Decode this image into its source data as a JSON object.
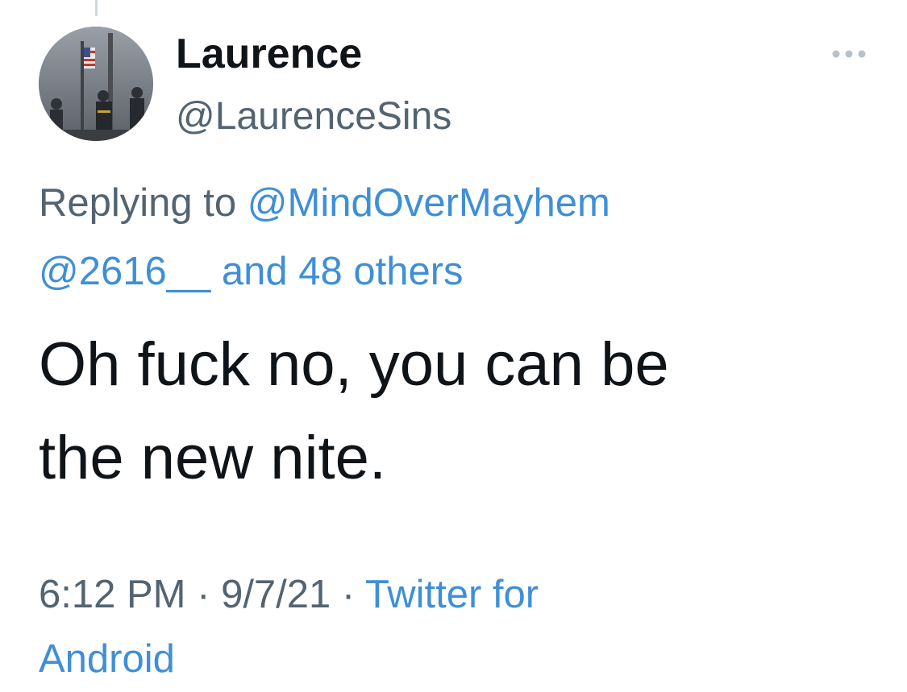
{
  "tweet": {
    "author": {
      "display_name": "Laurence",
      "handle": "@LaurenceSins",
      "avatar_icon": "profile-photo"
    },
    "more_icon": "more-options-icon",
    "replying": {
      "prefix": "Replying to",
      "mention_1": "@MindOverMayhem",
      "mention_2": "@2616__",
      "others": "and 48 others"
    },
    "text_line_1": "Oh fuck no, you can be",
    "text_line_2": "the new nite.",
    "meta": {
      "time": "6:12 PM",
      "separator": "·",
      "date": "9/7/21",
      "source_line_1": "Twitter for",
      "source_line_2": "Android"
    },
    "colors": {
      "text": "#0f1419",
      "secondary": "#536471",
      "link": "#3f8fd6"
    }
  }
}
